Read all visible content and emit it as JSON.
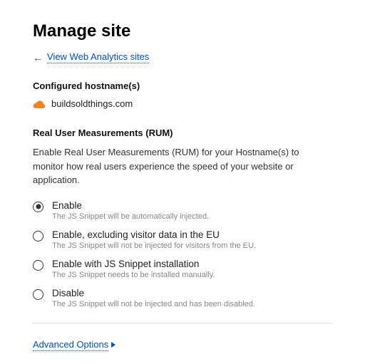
{
  "page": {
    "title": "Manage site",
    "back_link": "View Web Analytics sites"
  },
  "hostnames": {
    "heading": "Configured hostname(s)",
    "value": "buildsoldthings.com"
  },
  "rum": {
    "heading": "Real User Measurements (RUM)",
    "description": "Enable Real User Measurements (RUM) for your Hostname(s) to monitor how real users experience the speed of your website or application.",
    "selected_index": 0,
    "options": [
      {
        "label": "Enable",
        "hint": "The JS Snippet will be automatically injected."
      },
      {
        "label": "Enable, excluding visitor data in the EU",
        "hint": "The JS Snippet will not be injected for visitors from the EU."
      },
      {
        "label": "Enable with JS Snippet installation",
        "hint": "The JS Snippet needs to be installed manually."
      },
      {
        "label": "Disable",
        "hint": "The JS Snippet will not be injected and has been disabled."
      }
    ]
  },
  "advanced": {
    "label": "Advanced Options"
  },
  "colors": {
    "link": "#0051c3",
    "cloud": "#f6821f"
  }
}
